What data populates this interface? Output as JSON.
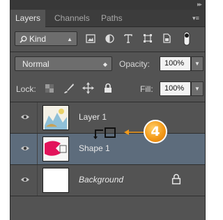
{
  "tabs": [
    {
      "label": "Layers",
      "active": true
    },
    {
      "label": "Channels",
      "active": false
    },
    {
      "label": "Paths",
      "active": false
    }
  ],
  "filter": {
    "kind_label": "Kind",
    "icons": [
      "image-filter-icon",
      "adjustment-filter-icon",
      "type-filter-icon",
      "shape-filter-icon",
      "smart-object-filter-icon",
      "filter-toggle-icon"
    ]
  },
  "blend": {
    "mode": "Normal",
    "opacity_label": "Opacity:",
    "opacity_value": "100%"
  },
  "lock": {
    "label": "Lock:",
    "fill_label": "Fill:",
    "fill_value": "100%",
    "icons": [
      "lock-transparent-icon",
      "lock-image-icon",
      "lock-position-icon",
      "lock-all-icon"
    ]
  },
  "layers": [
    {
      "name": "Layer 1",
      "visible": true,
      "selected": false
    },
    {
      "name": "Shape 1",
      "visible": true,
      "selected": true
    },
    {
      "name": "Background",
      "visible": true,
      "selected": false,
      "locked": true
    }
  ],
  "callout": {
    "number": "4",
    "color": "#f39a19"
  },
  "colors": {
    "panel": "#535353",
    "selected_row": "#5d6c7c",
    "shape_fill": "#e2135b"
  }
}
